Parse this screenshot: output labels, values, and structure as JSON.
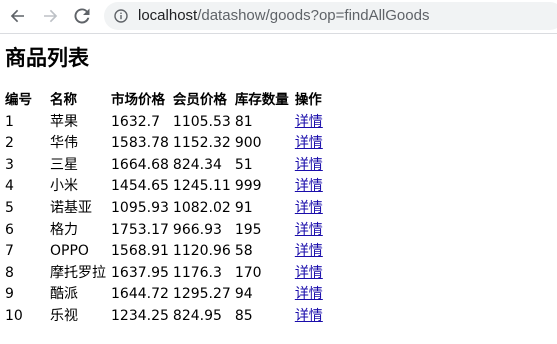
{
  "browser": {
    "url_host": "localhost",
    "url_path": "/datashow/goods?op=findAllGoods"
  },
  "page": {
    "title": "商品列表"
  },
  "table": {
    "headers": [
      "编号",
      "名称",
      "市场价格",
      "会员价格",
      "库存数量",
      "操作"
    ],
    "rows": [
      {
        "id": "1",
        "name": "苹果",
        "market_price": "1632.7",
        "member_price": "1105.53",
        "stock": "81",
        "action": "详情"
      },
      {
        "id": "2",
        "name": "华伟",
        "market_price": "1583.78",
        "member_price": "1152.32",
        "stock": "900",
        "action": "详情"
      },
      {
        "id": "3",
        "name": "三星",
        "market_price": "1664.68",
        "member_price": "824.34",
        "stock": "51",
        "action": "详情"
      },
      {
        "id": "4",
        "name": "小米",
        "market_price": "1454.65",
        "member_price": "1245.11",
        "stock": "999",
        "action": "详情"
      },
      {
        "id": "5",
        "name": "诺基亚",
        "market_price": "1095.93",
        "member_price": "1082.02",
        "stock": "91",
        "action": "详情"
      },
      {
        "id": "6",
        "name": "格力",
        "market_price": "1753.17",
        "member_price": "966.93",
        "stock": "195",
        "action": "详情"
      },
      {
        "id": "7",
        "name": "OPPO",
        "market_price": "1568.91",
        "member_price": "1120.96",
        "stock": "58",
        "action": "详情"
      },
      {
        "id": "8",
        "name": "摩托罗拉",
        "market_price": "1637.95",
        "member_price": "1176.3",
        "stock": "170",
        "action": "详情"
      },
      {
        "id": "9",
        "name": "酷派",
        "market_price": "1644.72",
        "member_price": "1295.27",
        "stock": "94",
        "action": "详情"
      },
      {
        "id": "10",
        "name": "乐视",
        "market_price": "1234.25",
        "member_price": "824.95",
        "stock": "85",
        "action": "详情"
      }
    ]
  },
  "icons": {
    "back": "back-arrow-icon",
    "forward": "forward-arrow-icon",
    "reload": "reload-icon",
    "info": "info-icon"
  },
  "colors": {
    "link": "#1a0dab",
    "omnibox_bg": "#f1f3f4",
    "nav_icon_active": "#5f6368",
    "nav_icon_disabled": "#bdc1c6"
  }
}
